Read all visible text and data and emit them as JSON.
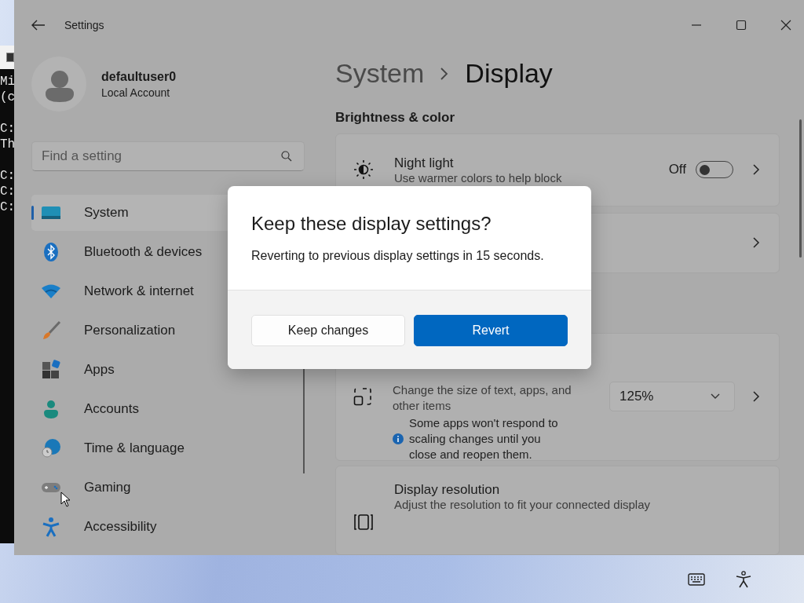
{
  "terminal": {
    "blocks": [
      [
        "Mi",
        "(c"
      ],
      [
        "C:",
        "Th"
      ],
      [
        "C:",
        "C:",
        "C:"
      ]
    ]
  },
  "window": {
    "title": "Settings"
  },
  "profile": {
    "name": "defaultuser0",
    "account": "Local Account"
  },
  "search": {
    "placeholder": "Find a setting"
  },
  "sidebar": {
    "items": [
      {
        "label": "System",
        "selected": true
      },
      {
        "label": "Bluetooth & devices",
        "selected": false
      },
      {
        "label": "Network & internet",
        "selected": false
      },
      {
        "label": "Personalization",
        "selected": false
      },
      {
        "label": "Apps",
        "selected": false
      },
      {
        "label": "Accounts",
        "selected": false
      },
      {
        "label": "Time & language",
        "selected": false
      },
      {
        "label": "Gaming",
        "selected": false
      },
      {
        "label": "Accessibility",
        "selected": false
      }
    ]
  },
  "breadcrumb": [
    "System",
    "Display"
  ],
  "section": "Brightness & color",
  "night_light": {
    "title": "Night light",
    "description": "Use warmer colors to help block",
    "state_label": "Off",
    "on": false
  },
  "scale": {
    "description": "Change the size of text, apps, and other items",
    "note": "Some apps won't respond to scaling changes until you close and reopen them.",
    "value": "125%"
  },
  "resolution": {
    "title": "Display resolution",
    "description": "Adjust the resolution to fit your connected display"
  },
  "dialog": {
    "title": "Keep these display settings?",
    "message": "Reverting to previous display settings in 15 seconds.",
    "buttons": [
      {
        "label": "Keep changes",
        "kind": "secondary"
      },
      {
        "label": "Revert",
        "kind": "primary"
      }
    ]
  }
}
